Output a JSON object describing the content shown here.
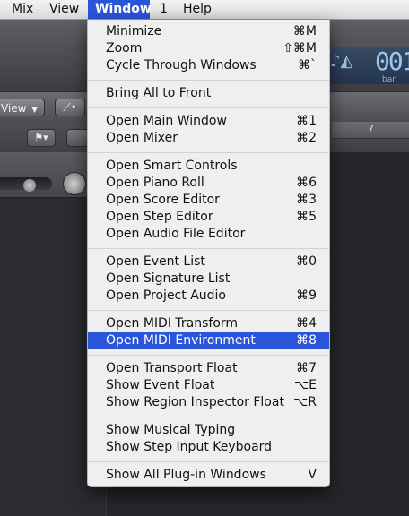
{
  "menubar": {
    "items": [
      "Mix",
      "View",
      "Window",
      "1",
      "Help"
    ]
  },
  "background": {
    "view_button": "View",
    "ruler_label": "7",
    "lcd_digits": "001",
    "lcd_label": "bar"
  },
  "menu": {
    "title": "Window",
    "items": [
      {
        "label": "Minimize",
        "shortcut": "⌘M"
      },
      {
        "label": "Zoom",
        "shortcut": "⇧⌘M"
      },
      {
        "label": "Cycle Through Windows",
        "shortcut": "⌘`"
      },
      {
        "label": "Bring All to Front",
        "shortcut": ""
      },
      {
        "label": "Open Main Window",
        "shortcut": "⌘1"
      },
      {
        "label": "Open Mixer",
        "shortcut": "⌘2"
      },
      {
        "label": "Open Smart Controls",
        "shortcut": ""
      },
      {
        "label": "Open Piano Roll",
        "shortcut": "⌘6"
      },
      {
        "label": "Open Score Editor",
        "shortcut": "⌘3"
      },
      {
        "label": "Open Step Editor",
        "shortcut": "⌘5"
      },
      {
        "label": "Open Audio File Editor",
        "shortcut": ""
      },
      {
        "label": "Open Event List",
        "shortcut": "⌘0"
      },
      {
        "label": "Open Signature List",
        "shortcut": ""
      },
      {
        "label": "Open Project Audio",
        "shortcut": "⌘9"
      },
      {
        "label": "Open MIDI Transform",
        "shortcut": "⌘4"
      },
      {
        "label": "Open MIDI Environment",
        "shortcut": "⌘8"
      },
      {
        "label": "Open Transport Float",
        "shortcut": "⌘7"
      },
      {
        "label": "Show Event Float",
        "shortcut": "⌥E"
      },
      {
        "label": "Show Region Inspector Float",
        "shortcut": "⌥R"
      },
      {
        "label": "Show Musical Typing",
        "shortcut": ""
      },
      {
        "label": "Show Step Input Keyboard",
        "shortcut": ""
      },
      {
        "label": "Show All Plug-in Windows",
        "shortcut": "V"
      }
    ]
  },
  "colors": {
    "highlight": "#2a55d9",
    "menu_bg": "#efefef"
  }
}
